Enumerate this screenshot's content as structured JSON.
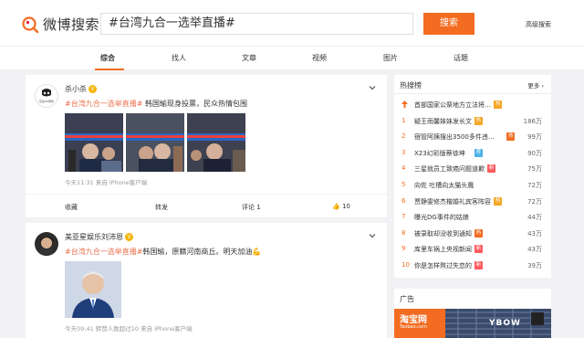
{
  "header": {
    "logo_text": "微博搜索",
    "search_value": "#台湾九合一选举直播#",
    "search_button": "搜索",
    "advanced_search": "高级搜索"
  },
  "tabs": [
    "综合",
    "找人",
    "文章",
    "视频",
    "图片",
    "话题"
  ],
  "posts": [
    {
      "user": "杀小杀",
      "topic": "#台湾九合一选举直播#",
      "text": " 韩国瑜现身投票，民众热情包围",
      "meta": "今天11:31 来自 iPhone客户端",
      "actions": {
        "collect": "收藏",
        "repost": "转发",
        "comment": "评论 1",
        "like": "10"
      }
    },
    {
      "user": "美亚星娱乐刘沛恩",
      "topic": "#台湾九合一选举直播#",
      "text": "韩国瑜，原籍河南商丘。明天加油💪",
      "meta": "今天09:41 转赞人数超过10 来自 iPhone客户端"
    }
  ],
  "sidebar": {
    "hot_title": "热搜榜",
    "more": "更多 ›",
    "items": [
      {
        "rank": "",
        "title": "首部国家公祭地方立法将…",
        "tag": "热",
        "tag_color": "#f5a623",
        "count": ""
      },
      {
        "rank": "1",
        "title": "疑王雨馨妹妹发长文",
        "tag": "热",
        "tag_color": "#f5a623",
        "count": "186万"
      },
      {
        "rank": "2",
        "title": "宿管阿姨搜出3500多件违…",
        "tag": "热",
        "tag_color": "#f36c21",
        "count": "99万"
      },
      {
        "rank": "3",
        "title": "X23幻彩版蔡徐坤",
        "tag": "荐",
        "tag_color": "#4db1e8",
        "count": "90万"
      },
      {
        "rank": "4",
        "title": "三星就员工致癌问题道歉",
        "tag": "新",
        "tag_color": "#ff5a5f",
        "count": "75万"
      },
      {
        "rank": "5",
        "title": "向佐 吐槽向太猫头鹰",
        "tag": "",
        "tag_color": "",
        "count": "72万"
      },
      {
        "rank": "6",
        "title": "贾静雯修杰楷婚礼宾客阵容",
        "tag": "热",
        "tag_color": "#f5a623",
        "count": "72万"
      },
      {
        "rank": "7",
        "title": "曝光DG事件的姑娘",
        "tag": "",
        "tag_color": "",
        "count": "44万"
      },
      {
        "rank": "8",
        "title": "被录取却没收到通知",
        "tag": "热",
        "tag_color": "#f36c21",
        "count": "43万"
      },
      {
        "rank": "9",
        "title": "库里车祸上央视新闻",
        "tag": "新",
        "tag_color": "#ff5a5f",
        "count": "43万"
      },
      {
        "rank": "10",
        "title": "你是怎样熬过失恋的",
        "tag": "新",
        "tag_color": "#ff5a5f",
        "count": "39万"
      }
    ],
    "ad_title": "广告",
    "ad_brand": "淘宝网",
    "ad_brand_sub": "Taobao.com",
    "ad_shirt_text": "YBOW"
  }
}
